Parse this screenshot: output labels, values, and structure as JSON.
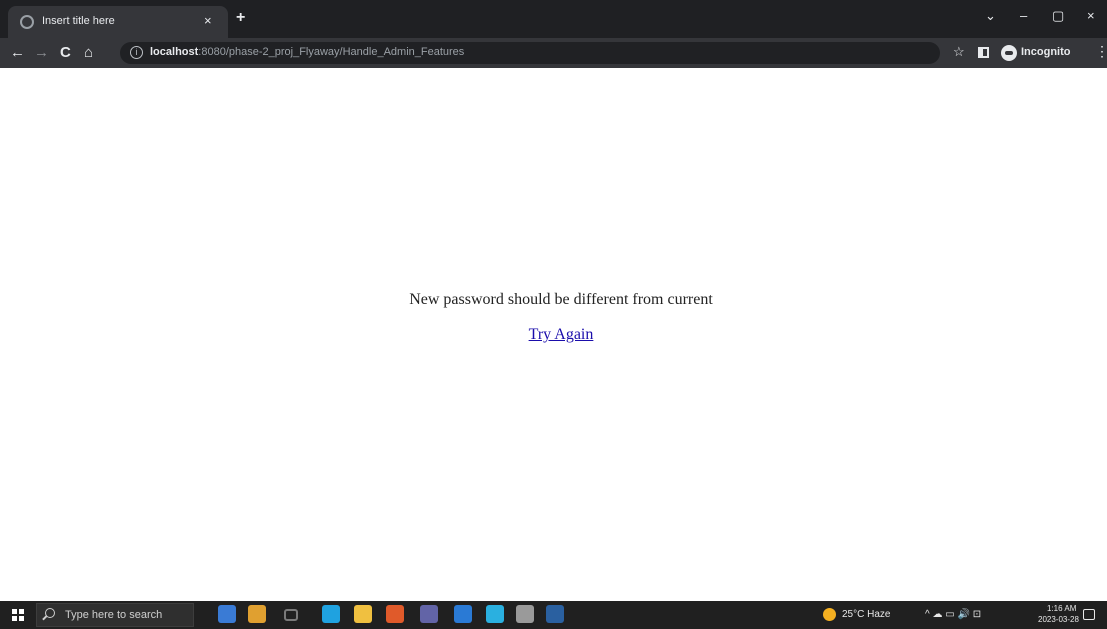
{
  "browser": {
    "tab_title": "Insert title here",
    "tab_close": "×",
    "new_tab": "+",
    "window_controls": {
      "minimize": "–",
      "restore": "▢",
      "close": "×",
      "tab_search": "⌄"
    },
    "nav": {
      "back": "←",
      "forward": "→",
      "reload": "C",
      "home": "⌂"
    },
    "url_host": "localhost",
    "url_rest": ":8080/phase-2_proj_Flyaway/Handle_Admin_Features",
    "bookmark_star": "☆",
    "profile_label": "Incognito",
    "menu": "⋮"
  },
  "page": {
    "message": "New password should be different from current",
    "retry_link": "Try Again"
  },
  "taskbar": {
    "search_placeholder": "Type here to search",
    "weather": "25°C  Haze",
    "tray_symbols": "^  ☁  ▭  🔊  ⊡",
    "time": "1:16 AM",
    "date": "2023-03-28",
    "app_colors": [
      "#3a7bd5",
      "#e0a030",
      "#7a7a7a",
      "#1fa2e0",
      "#f0c040",
      "#e05a2a",
      "#6264a7",
      "#2a7ad5",
      "#2ab0e0",
      "#9a9a9a",
      "#2a60a0"
    ],
    "app_icons": [
      "file-explorer-icon",
      "briefcase-icon",
      "task-view-icon",
      "edge-icon",
      "file-manager-icon",
      "chrome-icon",
      "teams-icon",
      "outlook-icon",
      "eclipse-icon",
      "terminal-icon",
      "app-icon"
    ]
  }
}
